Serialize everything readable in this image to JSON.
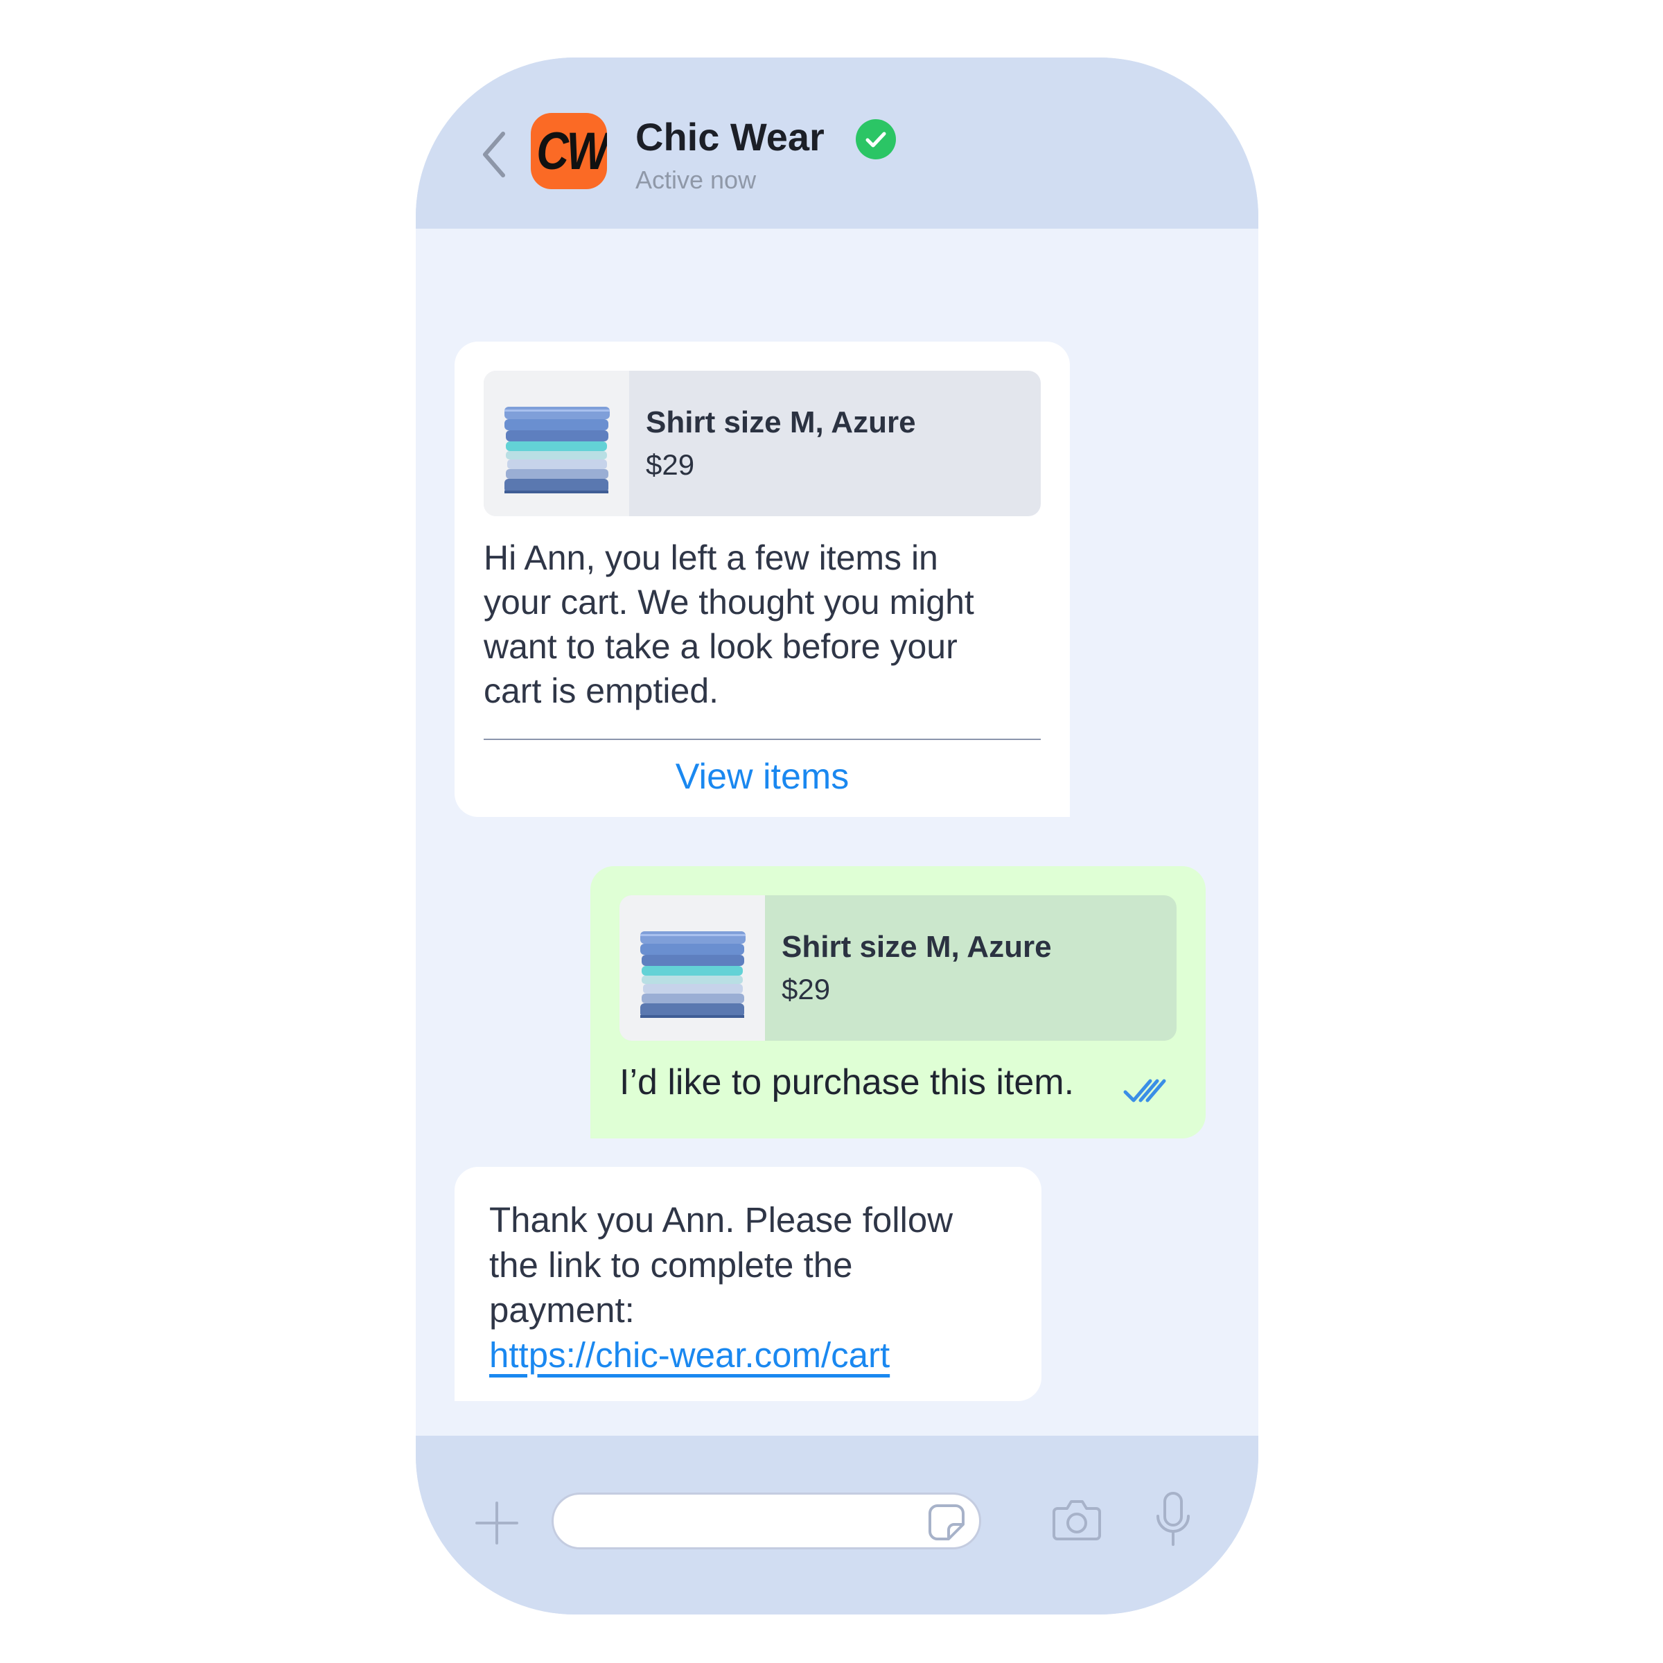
{
  "header": {
    "back_icon": "chevron-left-icon",
    "logo_text": "CW",
    "logo_color": "#fb6a25",
    "title": "Chic Wear",
    "verified_icon": "verified-check-icon",
    "verified_color": "#2bc565",
    "status": "Active now"
  },
  "messages": [
    {
      "direction": "incoming",
      "product": {
        "name": "Shirt size M, Azure",
        "price": "$29",
        "image_icon": "folded-shirts-image"
      },
      "text": "Hi Ann, you left a few items in\nyour cart. We thought you might\nwant to take a look before your\ncart is emptied.",
      "action_label": "View items"
    },
    {
      "direction": "outgoing",
      "product": {
        "name": "Shirt size M, Azure",
        "price": "$29",
        "image_icon": "folded-shirts-image"
      },
      "text": "I’d like to purchase this item.",
      "status_icon": "double-check-read-icon"
    },
    {
      "direction": "incoming",
      "text": "Thank you Ann. Please follow\nthe link to complete the\npayment:",
      "link": "https://chic-wear.com/cart"
    }
  ],
  "composer": {
    "attach_icon": "plus-icon",
    "sticker_icon": "sticker-icon",
    "camera_icon": "camera-icon",
    "mic_icon": "microphone-icon",
    "input_value": ""
  },
  "colors": {
    "frame": "#d1ddf2",
    "chat_background": "#edf2fc",
    "incoming_bubble": "#ffffff",
    "outgoing_bubble": "#dfffd5",
    "link": "#1a88f0"
  }
}
